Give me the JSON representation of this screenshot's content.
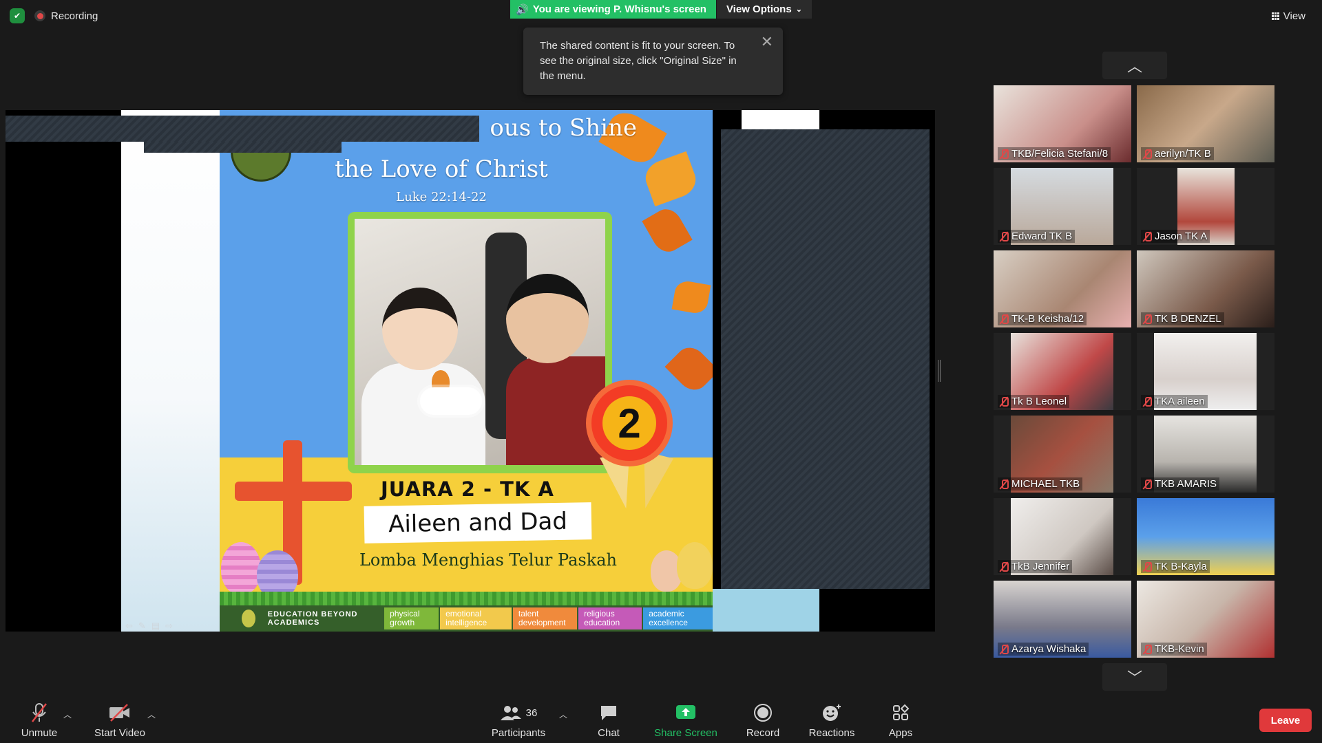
{
  "top": {
    "recording_label": "Recording",
    "share_banner": "You are viewing P. Whisnu's screen",
    "view_options": "View Options",
    "view_button": "View"
  },
  "tooltip": {
    "text": "The shared content is fit to your screen. To see the original size, click \"Original Size\" in the menu."
  },
  "slide": {
    "title_line1": "ous to Shine",
    "title_line2": "the Love of Christ",
    "verse": "Luke 22:14-22",
    "rank_number": "2",
    "juara": "JUARA 2 - TK A",
    "names": "Aileen and Dad",
    "competition": "Lomba Menghias Telur Paskah",
    "footer_text": "EDUCATION BEYOND ACADEMICS",
    "pills": [
      {
        "label": "physical growth",
        "color": "#7fb83a"
      },
      {
        "label": "emotional intelligence",
        "color": "#f2c94c"
      },
      {
        "label": "talent development",
        "color": "#f08a3c"
      },
      {
        "label": "religious education",
        "color": "#c55ab8"
      },
      {
        "label": "academic excellence",
        "color": "#3b9be0"
      }
    ]
  },
  "participants": [
    {
      "name": "TKB/Felicia Stefani/8"
    },
    {
      "name": "aerilyn/TK B"
    },
    {
      "name": "Edward TK B"
    },
    {
      "name": "Jason TK A"
    },
    {
      "name": "TK-B Keisha/12"
    },
    {
      "name": "TK B DENZEL"
    },
    {
      "name": "Tk B Leonel"
    },
    {
      "name": "TKA aileen"
    },
    {
      "name": "MICHAEL TKB"
    },
    {
      "name": "TKB AMARIS"
    },
    {
      "name": "TkB Jennifer"
    },
    {
      "name": "TK B-Kayla"
    },
    {
      "name": "Azarya Wishaka"
    },
    {
      "name": "TKB-Kevin"
    }
  ],
  "toolbar": {
    "unmute": "Unmute",
    "start_video": "Start Video",
    "participants": "Participants",
    "participant_count": "36",
    "chat": "Chat",
    "share_screen": "Share Screen",
    "record": "Record",
    "reactions": "Reactions",
    "apps": "Apps",
    "leave": "Leave"
  },
  "colors": {
    "share_green": "#23c065",
    "leave_red": "#e0393b",
    "mute_red": "#e04848"
  }
}
